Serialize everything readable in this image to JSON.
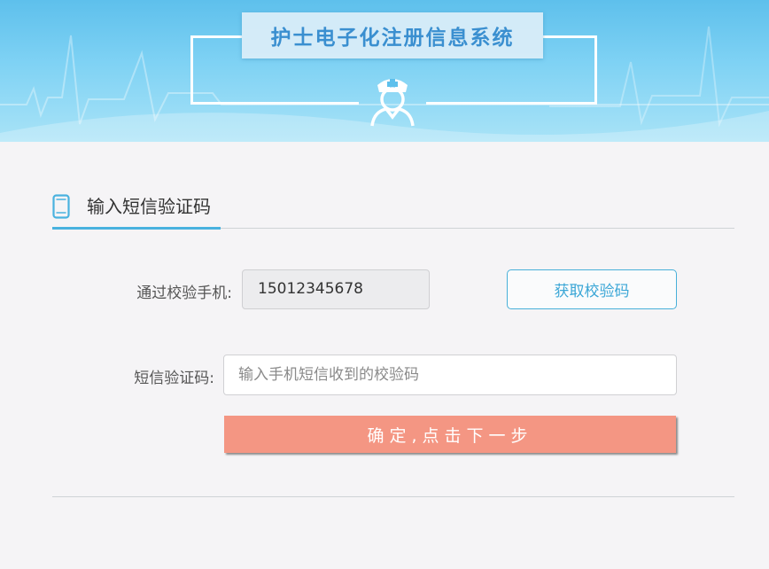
{
  "header": {
    "system_title": "护士电子化注册信息系统",
    "icon": "nurse-icon"
  },
  "section": {
    "title": "输入短信验证码",
    "icon": "mobile-phone-icon"
  },
  "form": {
    "phone_label": "通过校验手机:",
    "phone_value": "15012345678",
    "get_code_label": "获取校验码",
    "sms_label": "短信验证码:",
    "sms_placeholder": "输入手机短信收到的校验码",
    "sms_value": "",
    "submit_label": "确定,点击下一步"
  },
  "colors": {
    "banner": "#5ec0ec",
    "accent": "#49b2df",
    "submit": "#f49683",
    "title_text": "#3a8fd0"
  }
}
